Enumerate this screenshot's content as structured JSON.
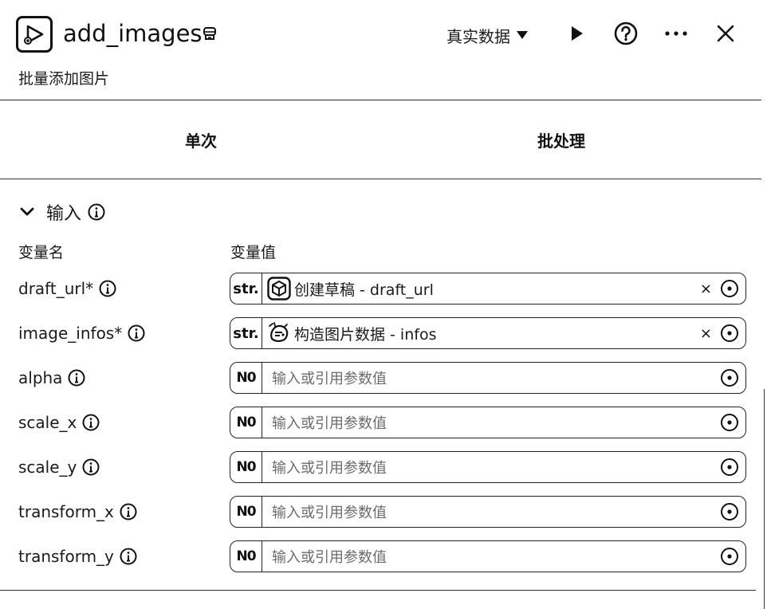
{
  "header": {
    "title": "add_images",
    "subtitle": "批量添加图片",
    "data_source": "真实数据",
    "icons": {
      "app": "video-play-icon",
      "badge": "store-icon",
      "run": "play-icon",
      "help": "help-icon",
      "more": "more-icon",
      "close": "close-icon"
    }
  },
  "tabs": [
    {
      "label": "单次"
    },
    {
      "label": "批处理"
    }
  ],
  "input_section": {
    "title": "输入",
    "col_name": "变量名",
    "col_value": "变量值",
    "rows": [
      {
        "name": "draft_url*",
        "type": "str.",
        "kind": "ref",
        "ref_icon": "cube-icon",
        "ref_text": "创建草稿 - draft_url"
      },
      {
        "name": "image_infos*",
        "type": "str.",
        "kind": "ref",
        "ref_icon": "mascot-icon",
        "ref_text": "构造图片数据 - infos"
      },
      {
        "name": "alpha",
        "type": "N0",
        "kind": "input",
        "placeholder": "输入或引用参数值"
      },
      {
        "name": "scale_x",
        "type": "N0",
        "kind": "input",
        "placeholder": "输入或引用参数值"
      },
      {
        "name": "scale_y",
        "type": "N0",
        "kind": "input",
        "placeholder": "输入或引用参数值"
      },
      {
        "name": "transform_x",
        "type": "N0",
        "kind": "input",
        "placeholder": "输入或引用参数值"
      },
      {
        "name": "transform_y",
        "type": "N0",
        "kind": "input",
        "placeholder": "输入或引用参数值"
      }
    ],
    "clear_symbol": "×"
  }
}
